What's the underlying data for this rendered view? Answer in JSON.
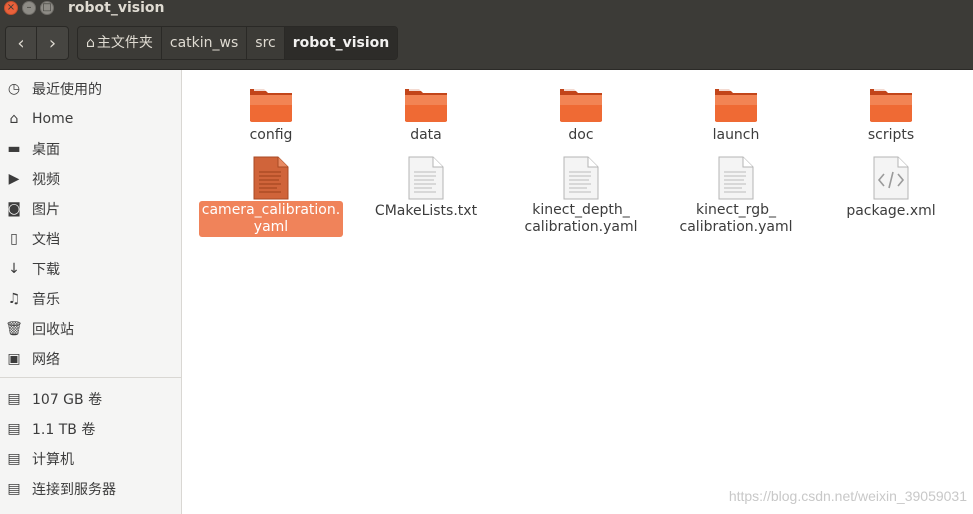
{
  "window": {
    "title": "robot_vision",
    "buttons": {
      "close": "×",
      "minimize": "–",
      "maximize": "□"
    }
  },
  "toolbar": {
    "back_icon": "‹",
    "forward_icon": "›",
    "breadcrumbs": [
      "主文件夹",
      "catkin_ws",
      "src",
      "robot_vision"
    ],
    "home_icon": "⌂"
  },
  "sidebar": {
    "items": [
      {
        "label": "最近使用的",
        "icon": "◷"
      },
      {
        "label": "Home",
        "icon": "⌂"
      },
      {
        "label": "桌面",
        "icon": "▬"
      },
      {
        "label": "视频",
        "icon": "▶"
      },
      {
        "label": "图片",
        "icon": "◙"
      },
      {
        "label": "文档",
        "icon": "▯"
      },
      {
        "label": "下载",
        "icon": "↓"
      },
      {
        "label": "音乐",
        "icon": "♫"
      },
      {
        "label": "回收站",
        "icon": "🗑"
      },
      {
        "label": "网络",
        "icon": "▣"
      },
      {
        "label": "107 GB 卷",
        "icon": "▤"
      },
      {
        "label": "1.1 TB 卷",
        "icon": "▤"
      },
      {
        "label": "计算机",
        "icon": "▤"
      },
      {
        "label": "连接到服务器",
        "icon": "▤"
      }
    ]
  },
  "files": [
    {
      "label": "config",
      "type": "folder"
    },
    {
      "label": "data",
      "type": "folder"
    },
    {
      "label": "doc",
      "type": "folder"
    },
    {
      "label": "launch",
      "type": "folder"
    },
    {
      "label": "scripts",
      "type": "folder"
    },
    {
      "label1": "camera_calibration.",
      "label2": "yaml",
      "type": "text-selected",
      "selected": true
    },
    {
      "label": "CMakeLists.txt",
      "type": "text"
    },
    {
      "label1": "kinect_depth_",
      "label2": "calibration.yaml",
      "type": "text"
    },
    {
      "label1": "kinect_rgb_",
      "label2": "calibration.yaml",
      "type": "text"
    },
    {
      "label": "package.xml",
      "type": "xml"
    }
  ],
  "watermark": "https://blog.csdn.net/weixin_39059031",
  "colors": {
    "accent": "#f0835a",
    "folder": "#e95420",
    "titlebar": "#3c3b37"
  }
}
